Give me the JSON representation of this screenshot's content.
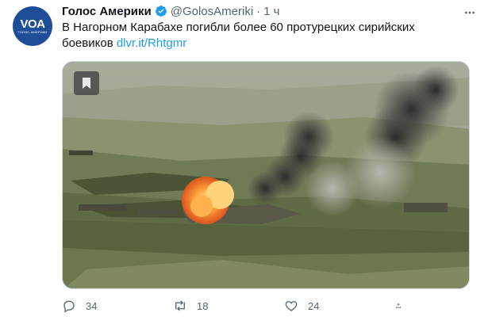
{
  "tweet": {
    "author_name": "Голос Америки",
    "author_handle": "@GolosAmeriki",
    "separator": "·",
    "time": "1 ч",
    "text": "В Нагорном Карабахе погибли более 60 протурецких сирийских боевиков",
    "link": "dlvr.it/Rhtgmr",
    "avatar": {
      "logo": "VOA",
      "sub": "ГОЛОС АМЕРИКИ"
    },
    "icons": {
      "verified": "verified-badge-icon",
      "more": "more-options-icon",
      "bookmark": "bookmark-icon",
      "reply": "reply-icon",
      "retweet": "retweet-icon",
      "like": "like-icon",
      "share": "share-icon"
    },
    "actions": {
      "replies": "34",
      "retweets": "18",
      "likes": "24"
    }
  },
  "colors": {
    "accent": "#1d9bf0",
    "secondary_text": "#536471",
    "avatar_bg": "#1f4e99"
  }
}
